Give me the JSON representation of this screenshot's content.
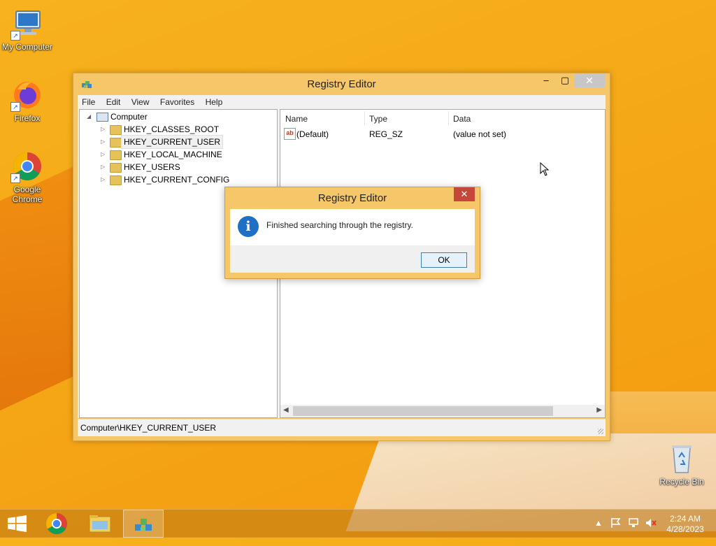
{
  "desktop": {
    "icons": [
      {
        "label": "My Computer"
      },
      {
        "label": "Firefox"
      },
      {
        "label": "Google Chrome"
      },
      {
        "label": "Recycle Bin"
      }
    ]
  },
  "window": {
    "title": "Registry Editor",
    "menu": [
      "File",
      "Edit",
      "View",
      "Favorites",
      "Help"
    ],
    "tree": {
      "root": "Computer",
      "children": [
        "HKEY_CLASSES_ROOT",
        "HKEY_CURRENT_USER",
        "HKEY_LOCAL_MACHINE",
        "HKEY_USERS",
        "HKEY_CURRENT_CONFIG"
      ],
      "selected": "HKEY_CURRENT_USER"
    },
    "list": {
      "columns": [
        "Name",
        "Type",
        "Data"
      ],
      "rows": [
        {
          "name": "(Default)",
          "type": "REG_SZ",
          "data": "(value not set)"
        }
      ]
    },
    "status": "Computer\\HKEY_CURRENT_USER"
  },
  "dialog": {
    "title": "Registry Editor",
    "message": "Finished searching through the registry.",
    "ok_label": "OK"
  },
  "taskbar": {
    "clock_time": "2:24 AM",
    "clock_date": "4/28/2023"
  },
  "colors": {
    "desktop": "#f5a816",
    "window_frame": "#f5c768",
    "dialog_close": "#c7463a",
    "info_icon": "#1f6fc5"
  }
}
